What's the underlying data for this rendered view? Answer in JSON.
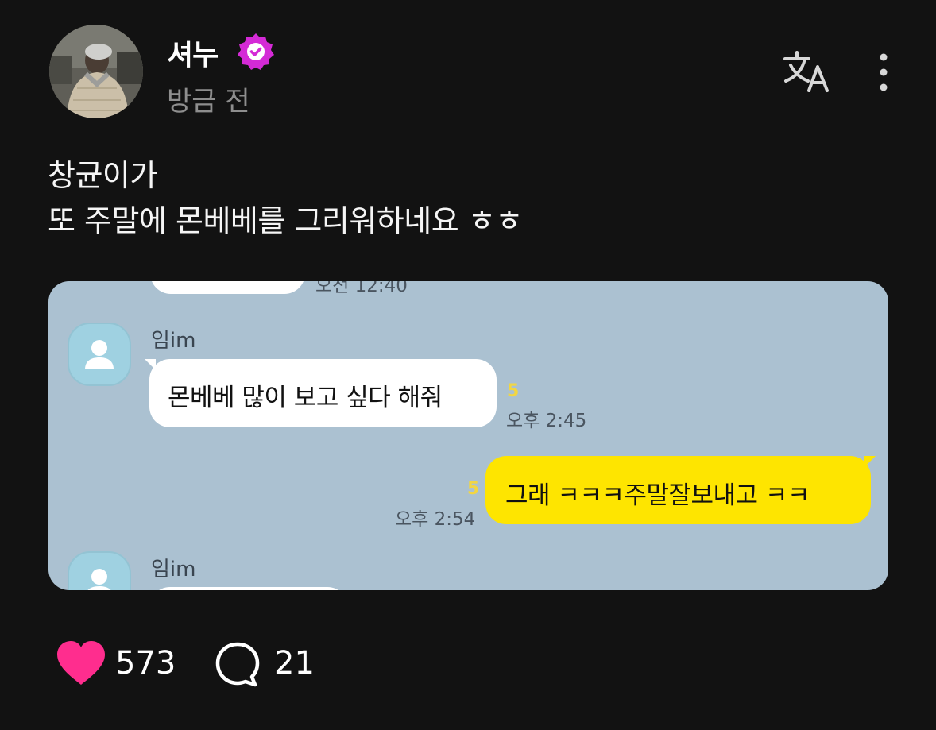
{
  "post": {
    "author": "셔누",
    "time": "방금 전",
    "text_lines": [
      "창균이가",
      "또 주말에 몬베베를 그리워하네요 ㅎㅎ"
    ]
  },
  "chat": {
    "top_time_cutoff": "오전 12:40",
    "messages": [
      {
        "sender": "임im",
        "text": "몬베베 많이 보고 싶다 해줘",
        "unread": "5",
        "time": "오후 2:45"
      },
      {
        "text": "그래 ㅋㅋㅋ주말잘보내고 ㅋㅋ",
        "unread": "5",
        "time": "오후 2:54"
      },
      {
        "sender": "임im"
      }
    ]
  },
  "actions": {
    "likes": "573",
    "comments": "21"
  },
  "colors": {
    "background": "#121212",
    "verified": "#d42ad6",
    "like": "#ff2d8e",
    "chat_bg": "#abc1d1",
    "my_bubble": "#fee500"
  },
  "icons": [
    "verified-badge-icon",
    "translate-icon",
    "more-options-icon",
    "heart-icon",
    "comment-icon",
    "default-profile-icon"
  ]
}
